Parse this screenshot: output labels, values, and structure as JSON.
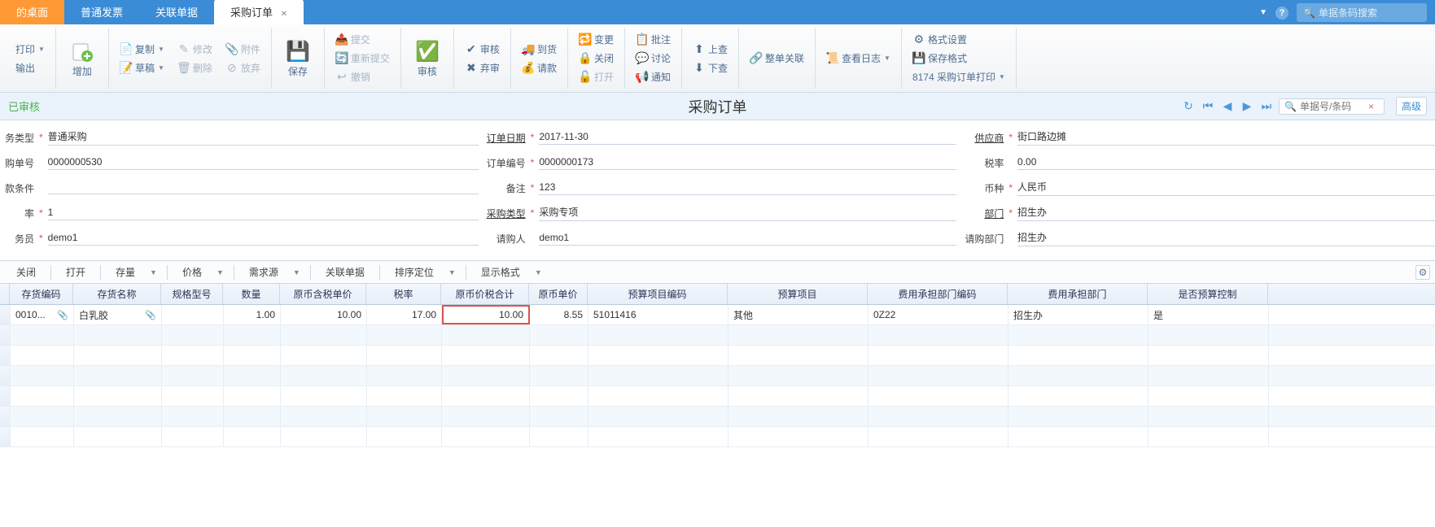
{
  "tabs": {
    "items": [
      {
        "label": "的桌面"
      },
      {
        "label": "普通发票"
      },
      {
        "label": "关联单据"
      },
      {
        "label": "采购订单"
      }
    ]
  },
  "topSearch": {
    "placeholder": "单据条码搜索"
  },
  "ribbon": {
    "print": "打印",
    "export": "输出",
    "add": "增加",
    "copy": "复制",
    "modify": "修改",
    "attach": "附件",
    "draft": "草稿",
    "delete": "删除",
    "abandon": "放弃",
    "save": "保存",
    "submit": "提交",
    "resubmit": "重新提交",
    "revoke": "撤销",
    "audit": "审核",
    "auditLabel": "审核",
    "abandonAudit": "弃审",
    "arrive": "到货",
    "pay": "请款",
    "change": "变更",
    "close": "关闭",
    "open": "打开",
    "approve": "批注",
    "discuss": "讨论",
    "notify": "通知",
    "up": "上查",
    "down": "下查",
    "relate": "整单关联",
    "viewlog": "查看日志",
    "format": "格式设置",
    "saveFormat": "保存格式",
    "template": "8174 采购订单打印"
  },
  "titlebar": {
    "left": "已审核",
    "title": "采购订单",
    "navSearchPlaceholder": "单据号/条码",
    "advanced": "高级"
  },
  "form": {
    "col1": {
      "busType": {
        "label": "务类型",
        "val": "普通采购"
      },
      "orderNo": {
        "label": "购单号",
        "val": "0000000530"
      },
      "payterm": {
        "label": "款条件",
        "val": ""
      },
      "rate": {
        "label": "率",
        "val": "1"
      },
      "staff": {
        "label": "务员",
        "val": "demo1"
      }
    },
    "col2": {
      "orderDate": {
        "label": "订单日期",
        "val": "2017-11-30"
      },
      "orderNum": {
        "label": "订单编号",
        "val": "0000000173"
      },
      "remark": {
        "label": "备注",
        "val": "123"
      },
      "purType": {
        "label": "采购类型",
        "val": "采购专项"
      },
      "requester": {
        "label": "请购人",
        "val": "demo1"
      }
    },
    "col3": {
      "supplier": {
        "label": "供应商",
        "val": "街口路边摊"
      },
      "taxrate": {
        "label": "税率",
        "val": "0.00"
      },
      "currency": {
        "label": "币种",
        "val": "人民币"
      },
      "dept": {
        "label": "部门",
        "val": "招生办"
      },
      "reqDept": {
        "label": "请购部门",
        "val": "招生办"
      }
    }
  },
  "tableToolbar": {
    "close": "关闭",
    "open": "打开",
    "stock": "存量",
    "price": "价格",
    "reqsrc": "需求源",
    "link": "关联单据",
    "sort": "排序定位",
    "display": "显示格式"
  },
  "grid": {
    "headers": {
      "code": "存货编码",
      "name": "存货名称",
      "spec": "规格型号",
      "qty": "数量",
      "price": "原币含税单价",
      "taxrate": "税率",
      "total": "原币价税合计",
      "unitprice": "原币单价",
      "budget": "预算项目编码",
      "budgetitem": "预算项目",
      "deptcode": "费用承担部门编码",
      "dept": "费用承担部门",
      "ctrl": "是否预算控制"
    },
    "rows": [
      {
        "code": "0010...",
        "name": "白乳胶",
        "spec": "",
        "qty": "1.00",
        "price": "10.00",
        "taxrate": "17.00",
        "total": "10.00",
        "unitprice": "8.55",
        "budget": "51011416",
        "budgetitem": "其他",
        "deptcode": "0Z22",
        "dept": "招生办",
        "ctrl": "是"
      }
    ]
  }
}
